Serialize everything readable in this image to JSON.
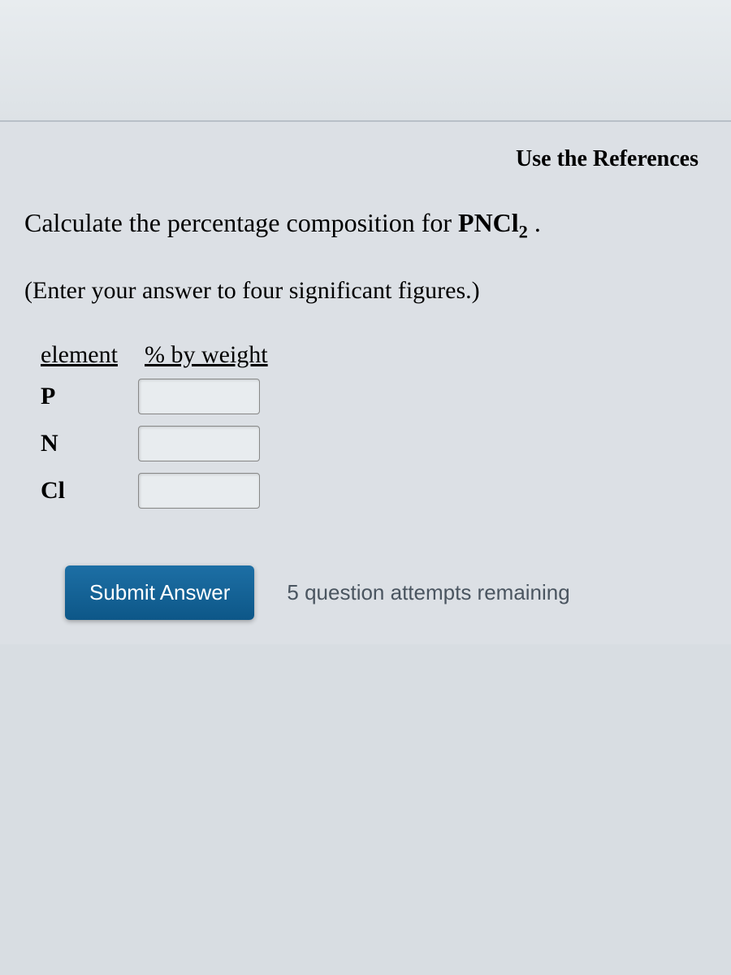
{
  "header": {
    "references_link": "Use the References"
  },
  "question": {
    "prompt_prefix": "Calculate the percentage composition for ",
    "formula_base": "PNCl",
    "formula_sub": "2",
    "prompt_suffix": " .",
    "instruction": "(Enter your answer to four significant figures.)"
  },
  "table": {
    "header_element": "element",
    "header_weight": "% by weight",
    "rows": [
      {
        "label": "P",
        "value": ""
      },
      {
        "label": "N",
        "value": ""
      },
      {
        "label": "Cl",
        "value": ""
      }
    ]
  },
  "footer": {
    "submit_label": "Submit Answer",
    "attempts_text": "5 question attempts remaining"
  }
}
